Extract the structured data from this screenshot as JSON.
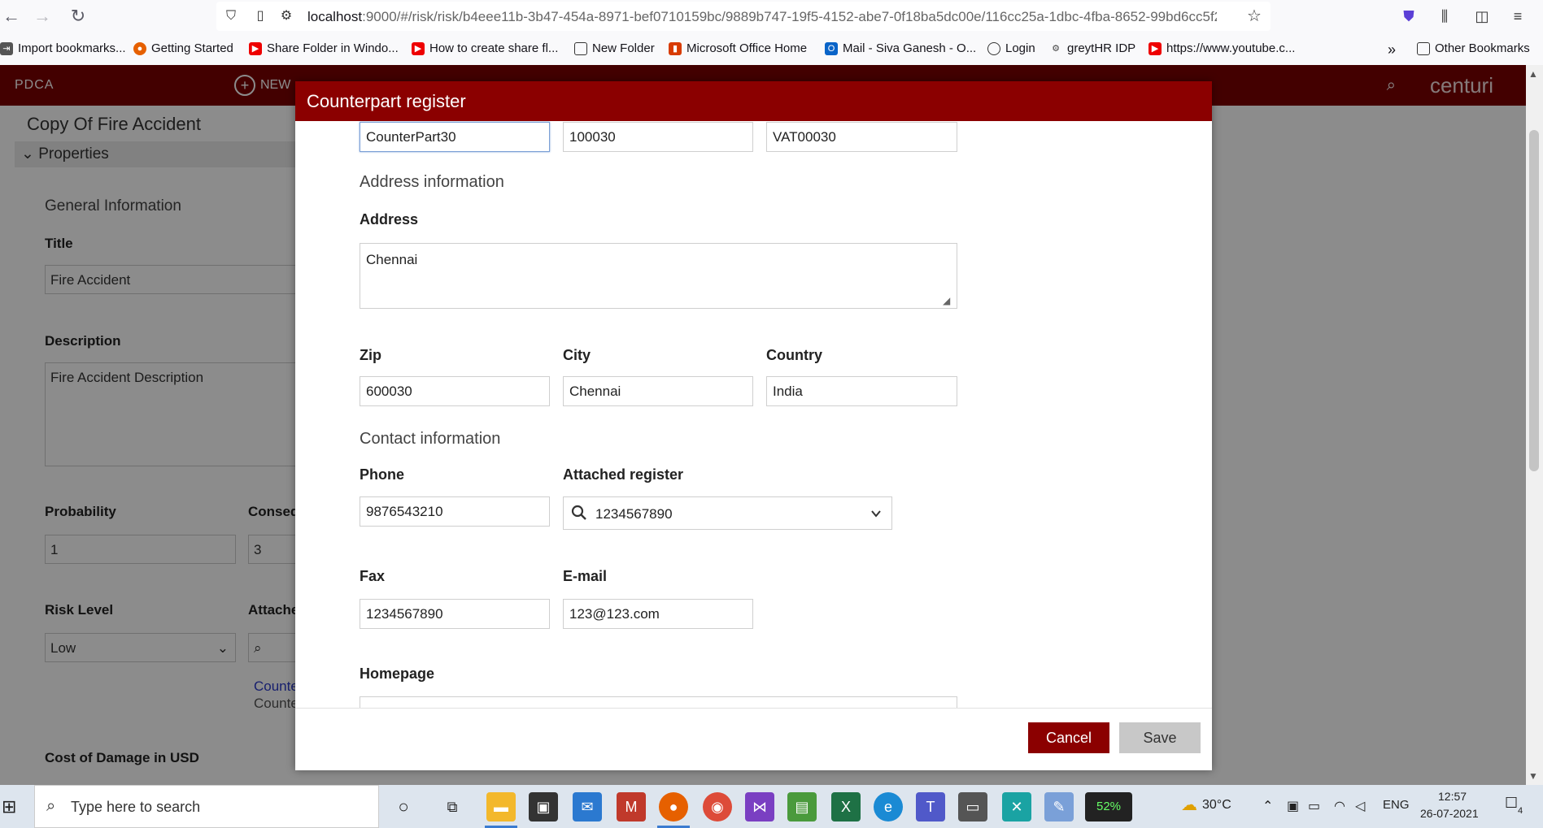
{
  "browser": {
    "url_host": "localhost",
    "url_rest": ":9000/#/risk/risk/b4eee11b-3b47-454a-8971-bef0710159bc/9889b747-19f5-4152-abe7-0f18ba5dc00e/116cc25a-1dbc-4fba-8652-99bd6cc5f2",
    "bookmarks": [
      "Import bookmarks...",
      "Getting Started",
      "Share Folder in Windo...",
      "How to create share fl...",
      "New Folder",
      "Microsoft Office Home",
      "Mail - Siva Ganesh - O...",
      "Login",
      "greytHR IDP",
      "https://www.youtube.c...",
      "Other Bookmarks"
    ]
  },
  "app": {
    "brand": "PDCA",
    "new_label": "NEW",
    "logo": "centuri",
    "page_title": "Copy Of Fire Accident",
    "properties_label": "Properties",
    "general_info": "General Information",
    "title_label": "Title",
    "title_value": "Fire Accident",
    "description_label": "Description",
    "description_value": "Fire Accident Description",
    "probability_label": "Probability",
    "probability_value": "1",
    "consequence_label": "Conseq",
    "consequence_value": "3",
    "risk_level_label": "Risk Level",
    "risk_level_value": "Low",
    "attached_label": "Attache",
    "link_1": "Counte",
    "link_2": "Counte",
    "cost_label": "Cost of Damage in USD"
  },
  "modal": {
    "title": "Counterpart register",
    "name_value": "CounterPart30",
    "number_value": "100030",
    "vat_value": "VAT00030",
    "address_section": "Address information",
    "address_label": "Address",
    "address_value": "Chennai",
    "zip_label": "Zip",
    "zip_value": "600030",
    "city_label": "City",
    "city_value": "Chennai",
    "country_label": "Country",
    "country_value": "India",
    "contact_section": "Contact information",
    "phone_label": "Phone",
    "phone_value": "9876543210",
    "attached_register_label": "Attached register",
    "attached_register_value": "1234567890",
    "fax_label": "Fax",
    "fax_value": "1234567890",
    "email_label": "E-mail",
    "email_value": "123@123.com",
    "homepage_label": "Homepage",
    "cancel_label": "Cancel",
    "save_label": "Save"
  },
  "taskbar": {
    "search_placeholder": "Type here to search",
    "battery": "52%",
    "weather": "30°C",
    "language": "ENG",
    "time": "12:57",
    "date": "26-07-2021",
    "notifications": "4"
  },
  "colors": {
    "brand_red": "#8b0000",
    "header_red": "#7b0000",
    "save_gray": "#c8c8c8"
  }
}
